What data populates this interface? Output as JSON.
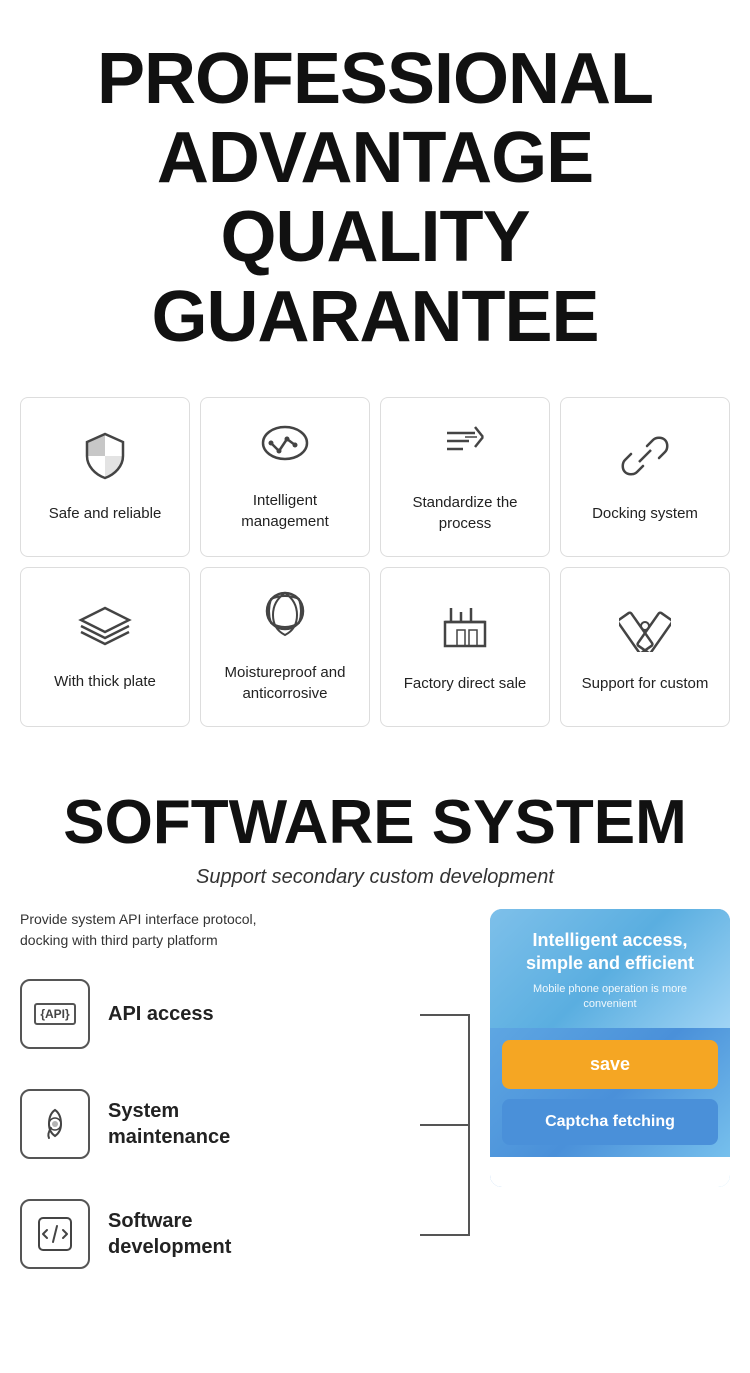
{
  "header": {
    "line1": "PROFESSIONAL",
    "line2": "ADVANTAGE",
    "line3": "QUALITY GUARANTEE"
  },
  "grid": {
    "row1": [
      {
        "icon": "shield",
        "label": "Safe and reliable"
      },
      {
        "icon": "cloud",
        "label": "Intelligent management"
      },
      {
        "icon": "process",
        "label": "Standardize the process"
      },
      {
        "icon": "link",
        "label": "Docking system"
      }
    ],
    "row2": [
      {
        "icon": "layers",
        "label": "With thick plate"
      },
      {
        "icon": "leaf",
        "label": "Moistureproof and anticorrosive"
      },
      {
        "icon": "factory",
        "label": "Factory direct sale"
      },
      {
        "icon": "custom",
        "label": "Support for custom"
      }
    ]
  },
  "software": {
    "title": "SOFTWARE SYSTEM",
    "subtitle": "Support secondary custom development",
    "provide_text": "Provide system API interface protocol,\ndocking with third party platform",
    "items": [
      {
        "icon": "api",
        "label": "API access"
      },
      {
        "icon": "maintenance",
        "label": "System\nmaintenance"
      },
      {
        "icon": "code",
        "label": "Software\ndevelopment"
      }
    ],
    "panel": {
      "main_text": "Intelligent access,\nsimple and efficient",
      "sub_text": "Mobile phone operation is more\nconvenient",
      "save_label": "save",
      "captcha_label": "Captcha fetching"
    }
  }
}
